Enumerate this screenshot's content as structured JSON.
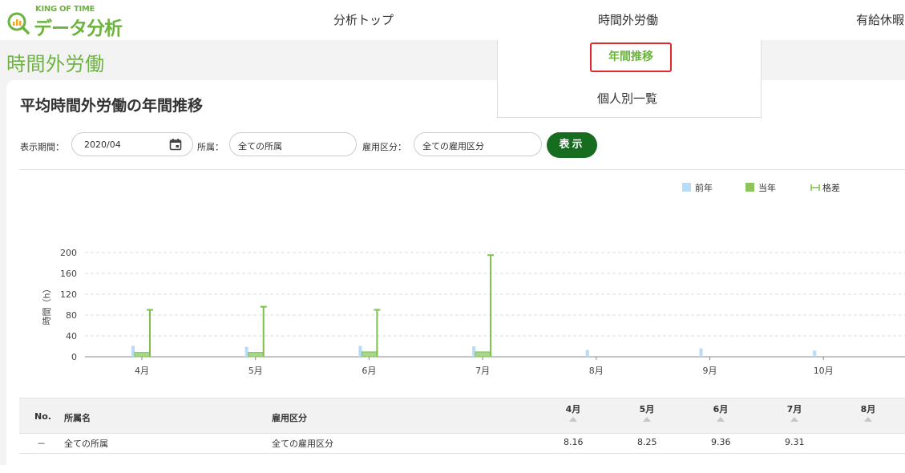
{
  "logo": {
    "brand_top": "KING OF TIME",
    "brand_main": "データ分析"
  },
  "nav": {
    "items": [
      "分析トップ",
      "時間外労働",
      "有給休暇"
    ]
  },
  "dropdown": {
    "items": [
      "年間推移",
      "個人別一覧"
    ]
  },
  "page": {
    "title": "時間外労働"
  },
  "card": {
    "title": "平均時間外労働の年間推移"
  },
  "filters": {
    "period_label": "表示期間：",
    "period_value": "2020/04",
    "dept_label": "所属：",
    "dept_value": "全ての所属",
    "employment_label": "雇用区分：",
    "employment_value": "全ての雇用区分",
    "show_button": "表示"
  },
  "legend": {
    "prev": "前年",
    "current": "当年",
    "diff": "格差"
  },
  "chart_data": {
    "type": "bar",
    "ylabel": "時間（h）",
    "ylim": [
      0,
      200
    ],
    "yticks": [
      0,
      40,
      80,
      120,
      160,
      200
    ],
    "categories": [
      "4月",
      "5月",
      "6月",
      "7月",
      "8月",
      "9月",
      "10月"
    ],
    "series": [
      {
        "name": "前年",
        "values": [
          21,
          19,
          21,
          20,
          13,
          16,
          12
        ]
      },
      {
        "name": "当年",
        "values": [
          8.16,
          8.25,
          9.36,
          9.31,
          null,
          null,
          null
        ]
      }
    ],
    "diff": {
      "name": "格差",
      "max_values": [
        90,
        96,
        90,
        195,
        null,
        null,
        null
      ]
    },
    "colors": {
      "prev": "#b8dcf5",
      "current": "#a8d68a",
      "current_border": "#7cc04b",
      "diff": "#7cc04b"
    },
    "grid": true,
    "legend_position": "top-right"
  },
  "table": {
    "headers": {
      "no": "No.",
      "dept": "所属名",
      "employment": "雇用区分"
    },
    "month_headers": [
      "4月",
      "5月",
      "6月",
      "7月",
      "8月"
    ],
    "rows": [
      {
        "no": "－",
        "dept": "全ての所属",
        "employment": "全ての雇用区分",
        "values": [
          "8.16",
          "8.25",
          "9.36",
          "9.31",
          ""
        ]
      }
    ]
  }
}
